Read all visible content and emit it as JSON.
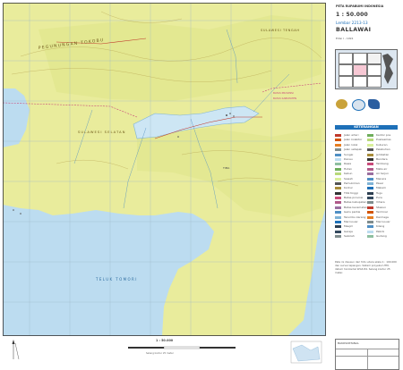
{
  "header": {
    "series": "PETA RUPABUMI INDONESIA",
    "scale": "1 : 50.000",
    "sheet_number": "Lembar 2213-13",
    "map_name": "BALLAWAI",
    "edition": "Edisi I - 1991"
  },
  "map_labels": {
    "peninsula": "PEGUNUNGAN TOKOBU",
    "province_ne": "SULAWESI TENGAH",
    "province_mid": "SULAWESI SELATAN",
    "bay": "TELUK TOMORI",
    "place": "TIMA",
    "boundary_note_1": "BATAS PROVINSI",
    "boundary_note_2": "BATAS KABUPATEN"
  },
  "legend": {
    "band_title": "KETERANGAN",
    "left_items": [
      "Jalan arteri",
      "Jalan kolektor",
      "Jalan lokal",
      "Jalan setapak",
      "Sungai",
      "Danau",
      "Rawa",
      "Hutan",
      "Kebun",
      "Sawah",
      "Pemukiman",
      "Kontur",
      "Titik tinggi",
      "Batas provinsi",
      "Batas kabupaten",
      "Batas kecamatan",
      "Garis pantai",
      "Terumbu karang",
      "Mercusuar",
      "Masjid",
      "Gereja",
      "Sekolah"
    ],
    "right_items": [
      "Kantor pos",
      "Puskesmas",
      "Kuburan",
      "Pelabuhan",
      "Jembatan",
      "Bandara",
      "Tambang",
      "Mata air",
      "Air terjun",
      "Menara",
      "Pasar",
      "Makam",
      "Tugu",
      "Pura",
      "Vihara",
      "Stasiun",
      "Terminal",
      "Dermaga",
      "Mercusuar",
      "Kilang",
      "Pabrik",
      "Gudang"
    ],
    "notes": "Peta ini disusun dari foto udara skala 1 : 100.000 dan survei lapangan. Sistem proyeksi UTM, datum horizontal WGS 84. Selang kontur 25 meter."
  },
  "bottom": {
    "scale_bar": "1 : 50.000",
    "contour_note": "Selang kontur 25 meter",
    "publisher": "BAKOSURTANAL"
  },
  "colors": {
    "land": "#e9ec9c",
    "highland": "#dfe68b",
    "water": "#bcdcf0",
    "lake": "#cde6f4",
    "grid": "#9fb7c9",
    "accent": "#1e70b8",
    "road": "#c0392b",
    "contour": "#a88c3a"
  }
}
